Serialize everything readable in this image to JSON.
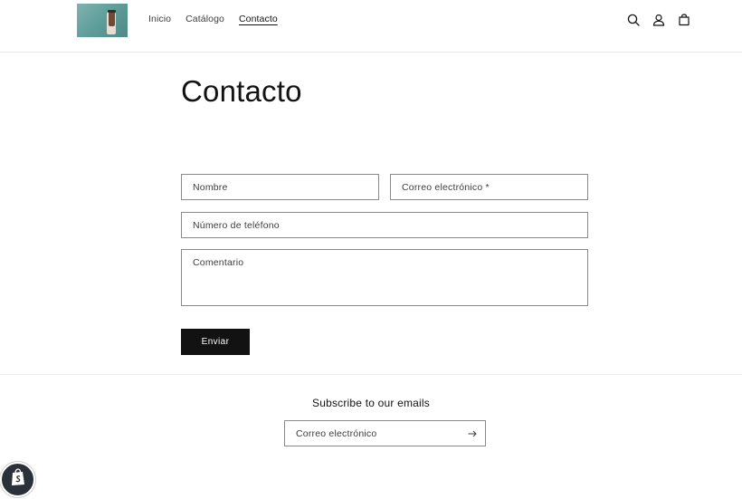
{
  "header": {
    "nav": [
      {
        "label": "Inicio",
        "active": false
      },
      {
        "label": "Catálogo",
        "active": false
      },
      {
        "label": "Contacto",
        "active": true
      }
    ],
    "icons": [
      "search-icon",
      "account-icon",
      "cart-icon"
    ]
  },
  "main": {
    "title": "Contacto",
    "form": {
      "name_placeholder": "Nombre",
      "email_placeholder": "Correo electrónico *",
      "phone_placeholder": "Número de teléfono",
      "comment_placeholder": "Comentario",
      "submit_label": "Enviar"
    }
  },
  "footer": {
    "subscribe_heading": "Subscribe to our emails",
    "email_placeholder": "Correo electrónico",
    "submit_icon": "arrow-right-icon"
  },
  "badge": {
    "icon": "shopify-bag-icon"
  },
  "colors": {
    "text": "#121212",
    "button_bg": "#121212",
    "button_text": "#ffffff",
    "border": "#8a8a8a",
    "badge_bg": "#2b3138"
  }
}
